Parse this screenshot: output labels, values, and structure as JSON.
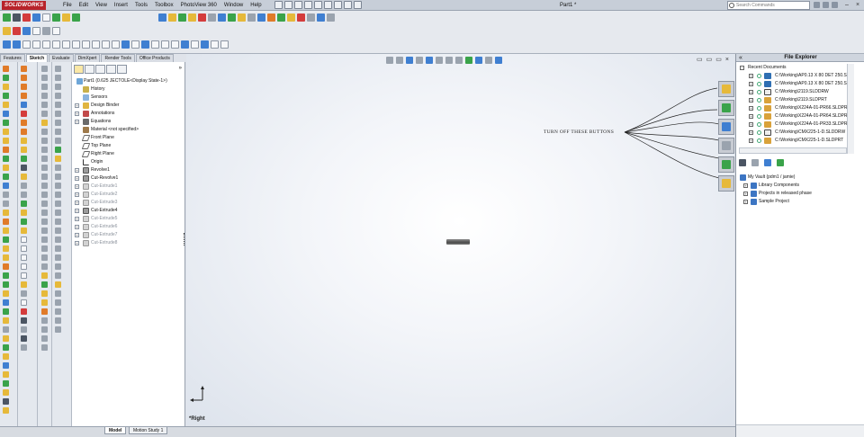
{
  "app": {
    "logo_text": "SOLIDWORKS",
    "menu": [
      "File",
      "Edit",
      "View",
      "Insert",
      "Tools",
      "Toolbox",
      "PhotoView 360",
      "Window",
      "Help"
    ],
    "document_title": "Part1 *",
    "search_placeholder": "Search Commands"
  },
  "command_manager": {
    "tabs": [
      "Features",
      "Sketch",
      "Evaluate",
      "DimXpert",
      "Render Tools",
      "Office Products"
    ],
    "active_tab": "Sketch"
  },
  "feature_tree": {
    "root": "Part1  (0.625 JECTOLE<Display State-1>)",
    "items": [
      {
        "label": "History",
        "icon": "history-icon",
        "expandable": false,
        "dim": false
      },
      {
        "label": "Sensors",
        "icon": "sensors-icon",
        "expandable": false,
        "dim": false
      },
      {
        "label": "Design Binder",
        "icon": "design-binder-icon",
        "expandable": true,
        "dim": false
      },
      {
        "label": "Annotations",
        "icon": "annotations-icon",
        "expandable": true,
        "dim": false
      },
      {
        "label": "Equations",
        "icon": "equations-icon",
        "expandable": true,
        "dim": false
      },
      {
        "label": "Material <not specified>",
        "icon": "material-icon",
        "expandable": false,
        "dim": false
      },
      {
        "label": "Front Plane",
        "icon": "plane-icon",
        "expandable": false,
        "dim": false
      },
      {
        "label": "Top Plane",
        "icon": "plane-icon",
        "expandable": false,
        "dim": false
      },
      {
        "label": "Right Plane",
        "icon": "plane-icon",
        "expandable": false,
        "dim": false
      },
      {
        "label": "Origin",
        "icon": "origin-icon",
        "expandable": false,
        "dim": false
      },
      {
        "label": "Revolve1",
        "icon": "revolve-icon",
        "expandable": true,
        "dim": false
      },
      {
        "label": "Cut-Revolve1",
        "icon": "cut-revolve-icon",
        "expandable": true,
        "dim": false
      },
      {
        "label": "Cut-Extrude1",
        "icon": "cut-extrude-icon",
        "expandable": true,
        "dim": true
      },
      {
        "label": "Cut-Extrude2",
        "icon": "cut-extrude-icon",
        "expandable": true,
        "dim": true
      },
      {
        "label": "Cut-Extrude3",
        "icon": "cut-extrude-icon",
        "expandable": true,
        "dim": true
      },
      {
        "label": "Cut-Extrude4",
        "icon": "cut-extrude-icon",
        "expandable": true,
        "dim": false
      },
      {
        "label": "Cut-Extrude5",
        "icon": "cut-extrude-icon",
        "expandable": true,
        "dim": true
      },
      {
        "label": "Cut-Extrude6",
        "icon": "cut-extrude-icon",
        "expandable": true,
        "dim": true
      },
      {
        "label": "Cut-Extrude7",
        "icon": "cut-extrude-icon",
        "expandable": true,
        "dim": true
      },
      {
        "label": "Cut-Extrude8",
        "icon": "cut-extrude-icon",
        "expandable": true,
        "dim": true
      }
    ]
  },
  "graphics": {
    "annotation": "TURN OFF THESE BUTTONS",
    "view_label": "*Right",
    "background_center": "#ffffff",
    "background_edge": "#dde3ec"
  },
  "bottom_tabs": [
    "Model",
    "Motion Study 1"
  ],
  "file_explorer": {
    "title": "File Explorer",
    "recent_header": "Recent Documents",
    "recent": [
      {
        "name": "C:\\Working\\AP0.13 X 80 DET 250.SL",
        "type": "assembly"
      },
      {
        "name": "C:\\Working\\AP0.13 X 80 DET 250.SL",
        "type": "assembly"
      },
      {
        "name": "C:\\Working\\2119.SLDDRW",
        "type": "drawing"
      },
      {
        "name": "C:\\Working\\2119.SLDPRT",
        "type": "part"
      },
      {
        "name": "C:\\Working\\X224A-01-PR66.SLDPR",
        "type": "part"
      },
      {
        "name": "C:\\Working\\X224A-01-PR64.SLDPR",
        "type": "part"
      },
      {
        "name": "C:\\Working\\X224A-01-PR33.SLDPR",
        "type": "part"
      },
      {
        "name": "C:\\Working\\CMX225-1-D.SLDDRW",
        "type": "drawing"
      },
      {
        "name": "C:\\Working\\CMX225-1-D.SLDPRT",
        "type": "part"
      }
    ],
    "vault": [
      {
        "label": "My Vault (pdm1 / jamie)",
        "level": 0
      },
      {
        "label": "Library Components",
        "level": 1
      },
      {
        "label": "Projects in released phase",
        "level": 1
      },
      {
        "label": "Sample Project",
        "level": 1
      }
    ]
  },
  "colors": {
    "accent_red": "#b8232a",
    "active_tab_highlight": "#fbe8a6"
  }
}
